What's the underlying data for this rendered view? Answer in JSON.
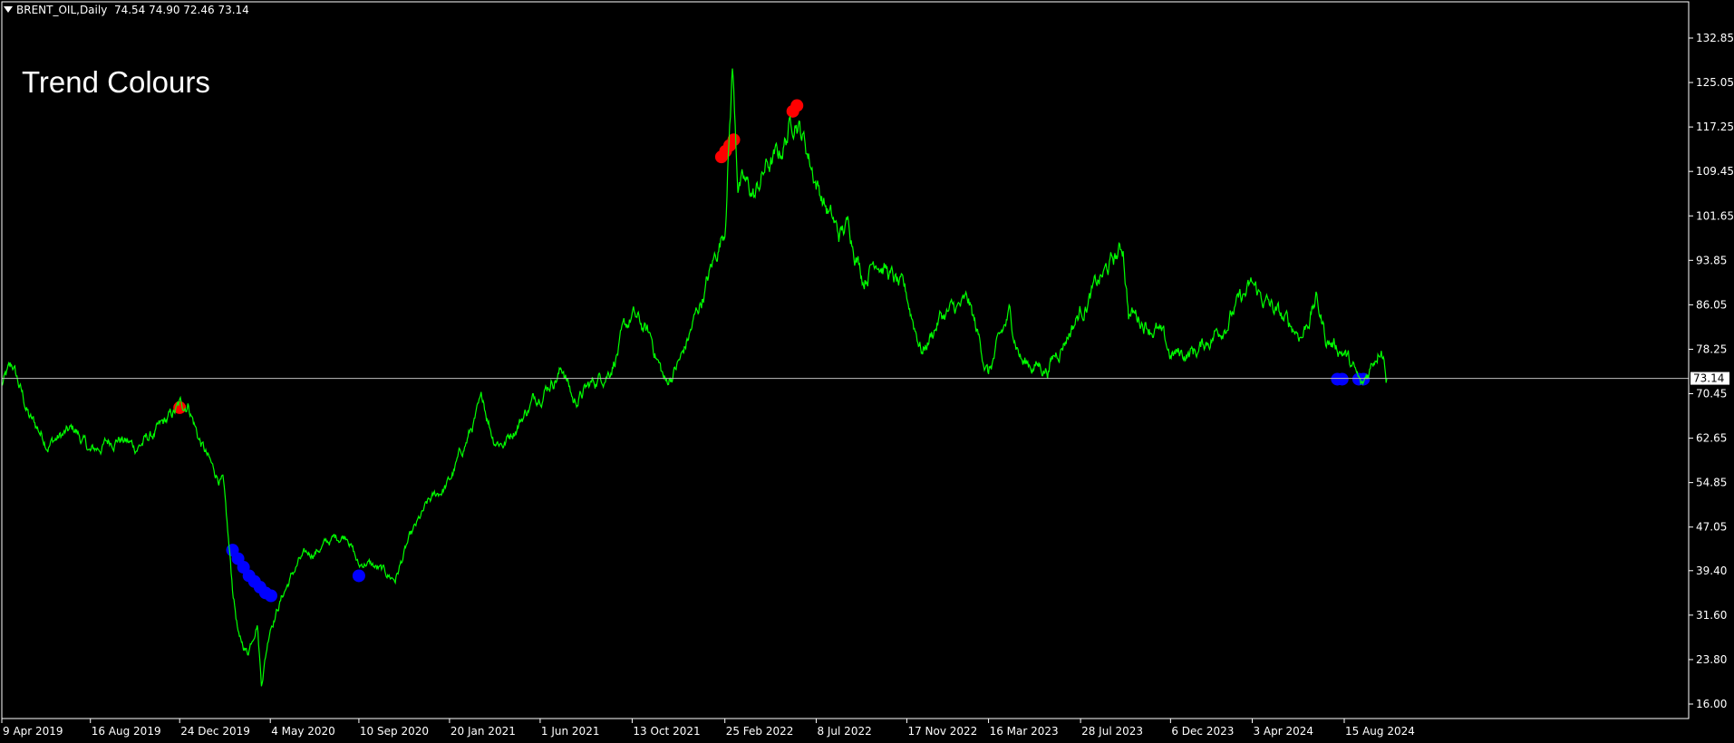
{
  "window": {
    "symbol": "BRENT_OIL,Daily",
    "ohlc": "74.54 74.90 72.46 73.14"
  },
  "overlay": {
    "title": "Trend Colours"
  },
  "colors": {
    "background": "#000000",
    "price_line": "#00ff00",
    "up_marker": "#ff0000",
    "down_marker": "#0000ff",
    "grid_and_axes": "#ffffff",
    "current_price_line": "#c0c0c0"
  },
  "chart_data": {
    "type": "line",
    "title": "",
    "xlabel": "",
    "ylabel": "",
    "grid": false,
    "ylim": [
      13.0,
      136.0
    ],
    "y_ticks": [
      "132.85",
      "125.05",
      "117.25",
      "109.45",
      "101.65",
      "93.85",
      "86.05",
      "78.25",
      "70.45",
      "62.65",
      "54.85",
      "47.05",
      "39.40",
      "31.60",
      "23.80",
      "16.00"
    ],
    "x_ticks": [
      "9 Apr 2019",
      "16 Aug 2019",
      "24 Dec 2019",
      "4 May 2020",
      "10 Sep 2020",
      "20 Jan 2021",
      "1 Jun 2021",
      "13 Oct 2021",
      "25 Feb 2022",
      "8 Jul 2022",
      "17 Nov 2022",
      "16 Mar 2023",
      "28 Jul 2023",
      "6 Dec 2023",
      "3 Apr 2024",
      "15 Aug 2024"
    ],
    "current_price": "73.14",
    "series": [
      {
        "x": [
          "9 Apr 2019",
          "25 Apr 2019",
          "20 May 2019",
          "15 Jun 2019",
          "25 Jul 2019",
          "16 Aug 2019",
          "25 Sep 2019",
          "20 Oct 2019",
          "25 Nov 2019",
          "24 Dec 2019",
          "6 Jan 2020",
          "20 Jan 2020",
          "10 Feb 2020",
          "25 Feb 2020",
          "10 Mar 2020",
          "20 Mar 2020",
          "1 Apr 2020",
          "15 Apr 2020",
          "21 Apr 2020",
          "4 May 2020",
          "25 May 2020",
          "15 Jun 2020",
          "10 Jul 2020",
          "5 Aug 2020",
          "25 Aug 2020",
          "10 Sep 2020",
          "20 Sep 2020",
          "15 Oct 2020",
          "2 Nov 2020",
          "20 Nov 2020",
          "20 Dec 2020",
          "20 Jan 2021",
          "20 Feb 2021",
          "10 Mar 2021",
          "25 Mar 2021",
          "10 Apr 2021",
          "1 Jun 2021",
          "5 Jul 2021",
          "20 Jul 2021",
          "15 Aug 2021",
          "10 Sep 2021",
          "13 Oct 2021",
          "10 Nov 2021",
          "1 Dec 2021",
          "25 Dec 2021",
          "25 Jan 2022",
          "10 Feb 2022",
          "25 Feb 2022",
          "8 Mar 2022",
          "16 Mar 2022",
          "10 Apr 2022",
          "25 Apr 2022",
          "15 May 2022",
          "8 Jun 2022",
          "8 Jul 2022",
          "20 Jul 2022",
          "10 Aug 2022",
          "25 Aug 2022",
          "15 Sep 2022",
          "5 Oct 2022",
          "25 Oct 2022",
          "17 Nov 2022",
          "10 Dec 2022",
          "5 Jan 2023",
          "15 Feb 2023",
          "16 Mar 2023",
          "15 Apr 2023",
          "5 May 2023",
          "10 Jun 2023",
          "28 Jul 2023",
          "10 Sep 2023",
          "28 Sep 2023",
          "6 Oct 2023",
          "15 Nov 2023",
          "6 Dec 2023",
          "15 Jan 2024",
          "15 Feb 2024",
          "3 Apr 2024",
          "20 May 2024",
          "15 Jun 2024",
          "5 Jul 2024",
          "20 Jul 2024",
          "15 Aug 2024",
          "10 Sep 2024",
          "25 Sep 2024",
          "8 Oct 2024",
          "14 Oct 2024",
          "16 Oct 2024"
        ],
        "values": [
          72,
          75,
          66,
          62,
          64,
          60,
          63,
          61,
          64,
          68,
          69,
          63,
          57,
          55,
          36,
          27,
          25,
          31,
          20,
          30,
          36,
          41,
          43,
          45,
          46,
          40,
          41,
          39,
          38,
          44,
          51,
          55,
          64,
          69,
          63,
          62,
          71,
          75,
          69,
          72,
          75,
          84,
          80,
          72,
          77,
          88,
          94,
          100,
          128,
          108,
          105,
          110,
          112,
          120,
          108,
          104,
          98,
          100,
          91,
          95,
          91,
          87,
          78,
          84,
          86,
          74,
          84,
          76,
          75,
          85,
          93,
          96,
          85,
          82,
          77,
          78,
          82,
          89,
          83,
          81,
          87,
          80,
          78,
          71,
          76,
          80,
          76,
          73.14
        ]
      }
    ],
    "markers": [
      {
        "type": "up",
        "x": "24 Dec 2019",
        "y": 68
      },
      {
        "type": "down",
        "x": "10 Mar 2020",
        "y": 43
      },
      {
        "type": "down",
        "x": "18 Mar 2020",
        "y": 41.5
      },
      {
        "type": "down",
        "x": "26 Mar 2020",
        "y": 40
      },
      {
        "type": "down",
        "x": "3 Apr 2020",
        "y": 38.5
      },
      {
        "type": "down",
        "x": "11 Apr 2020",
        "y": 37.5
      },
      {
        "type": "down",
        "x": "19 Apr 2020",
        "y": 36.5
      },
      {
        "type": "down",
        "x": "27 Apr 2020",
        "y": 35.5
      },
      {
        "type": "down",
        "x": "5 May 2020",
        "y": 35
      },
      {
        "type": "down",
        "x": "10 Sep 2020",
        "y": 38.5
      },
      {
        "type": "up",
        "x": "20 Feb 2022",
        "y": 112
      },
      {
        "type": "up",
        "x": "26 Feb 2022",
        "y": 113
      },
      {
        "type": "up",
        "x": "4 Mar 2022",
        "y": 114
      },
      {
        "type": "up",
        "x": "10 Mar 2022",
        "y": 115
      },
      {
        "type": "up",
        "x": "4 Jun 2022",
        "y": 120
      },
      {
        "type": "up",
        "x": "10 Jun 2022",
        "y": 121
      },
      {
        "type": "down",
        "x": "5 Aug 2024",
        "y": 73
      },
      {
        "type": "down",
        "x": "12 Aug 2024",
        "y": 73
      },
      {
        "type": "down",
        "x": "5 Sep 2024",
        "y": 73
      },
      {
        "type": "down",
        "x": "12 Sep 2024",
        "y": 73
      }
    ]
  }
}
